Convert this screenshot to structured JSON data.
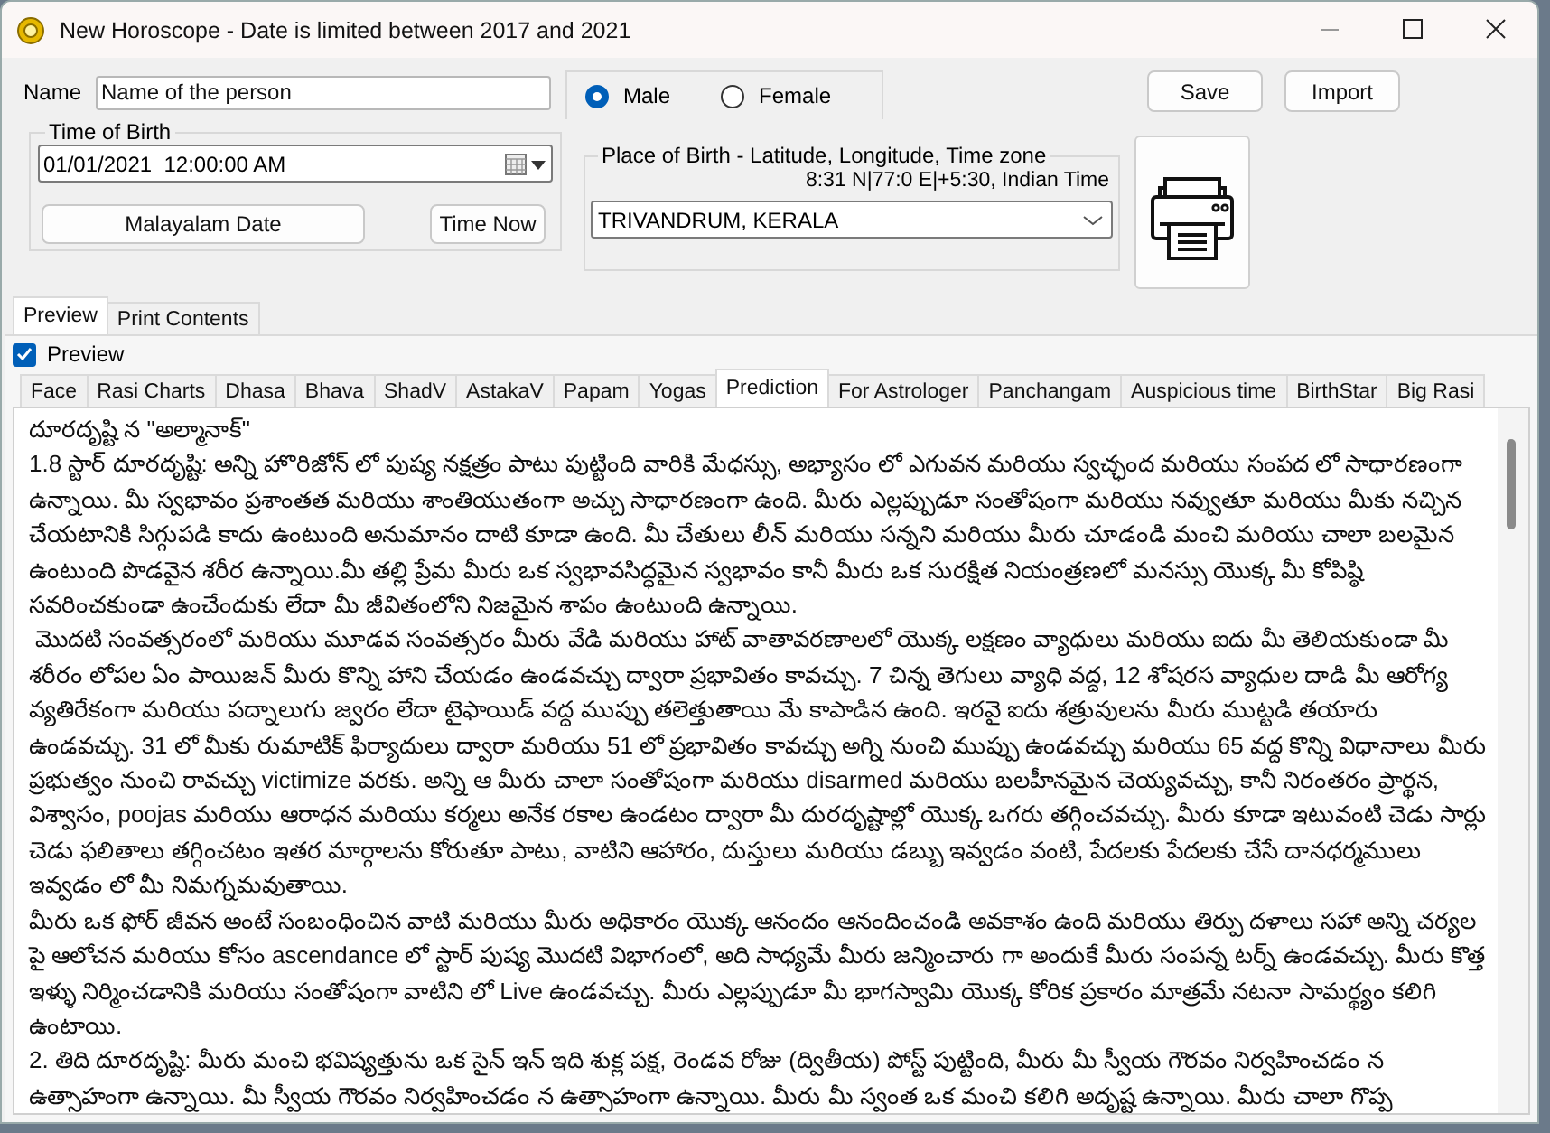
{
  "window": {
    "title": "New Horoscope - Date is limited between 2017 and 2021"
  },
  "name": {
    "label": "Name",
    "value": "Name of the person"
  },
  "gender": [
    {
      "label": "Male",
      "selected": true
    },
    {
      "label": "Female",
      "selected": false
    }
  ],
  "buttons": [
    "Save",
    "Import"
  ],
  "time_of_birth": {
    "title": "Time of Birth",
    "value": "01/01/2021  12:00:00 AM",
    "buttons": [
      "Malayalam Date",
      "Time Now"
    ]
  },
  "place_of_birth": {
    "title": "Place of Birth - Latitude, Longitude, Time zone",
    "coordinates": "8:31 N|77:0 E|+5:30, Indian Time",
    "value": "TRIVANDRUM, KERALA"
  },
  "outer_tabs": [
    {
      "label": "Preview",
      "selected": true
    },
    {
      "label": "Print Contents",
      "selected": false
    }
  ],
  "preview_checkbox": {
    "label": "Preview",
    "checked": true
  },
  "tabs": [
    {
      "label": "Face",
      "selected": false
    },
    {
      "label": "Rasi Charts",
      "selected": false
    },
    {
      "label": "Dhasa",
      "selected": false
    },
    {
      "label": "Bhava",
      "selected": false
    },
    {
      "label": "ShadV",
      "selected": false
    },
    {
      "label": "AstakaV",
      "selected": false
    },
    {
      "label": "Papam",
      "selected": false
    },
    {
      "label": "Yogas",
      "selected": false
    },
    {
      "label": "Prediction",
      "selected": true
    },
    {
      "label": "For Astrologer",
      "selected": false
    },
    {
      "label": "Panchangam",
      "selected": false
    },
    {
      "label": "Auspicious time",
      "selected": false
    },
    {
      "label": "BirthStar",
      "selected": false
    },
    {
      "label": "Big Rasi",
      "selected": false
    }
  ],
  "prediction_text": [
    "దూరదృష్టి న \"అల్మానాక్\"",
    "1.8 స్టార్ దూరదృష్టి: అన్ని హొరిజోన్ లో పుష్య నక్షత్రం పాటు పుట్టింది వారికి మేధస్సు, అభ్యాసం లో ఎగువన మరియు స్వచ్ఛంద మరియు సంపద లో సాధారణంగా ఉన్నాయి. మీ స్వభావం ప్రశాంతత మరియు శాంతియుతంగా అచ్చు సాధారణంగా ఉంది. మీరు ఎల్లప్పుడూ సంతోషంగా మరియు నవ్వుతూ మరియు మీకు నచ్చిన చేయటానికి సిగ్గుపడి కాదు ఉంటుంది అనుమానం దాటి కూడా ఉంది. మీ చేతులు లీన్ మరియు సన్నని మరియు మీరు చూడండి మంచి మరియు చాలా బలమైన ఉంటుంది పొడవైన శరీర ఉన్నాయి.మీ తల్లి ప్రేమ మీరు ఒక స్వభావసిద్ధమైన స్వభావం కానీ మీరు ఒక సురక్షిత నియంత్రణలో మనస్సు యొక్క మీ కోపిష్ఠి సవరించకుండా ఉంచేందుకు లేదా మీ జీవితంలోని నిజమైన శాపం ఉంటుంది ఉన్నాయి.",
    " మొదటి సంవత్సరంలో మరియు మూడవ సంవత్సరం మీరు వేడి మరియు హాట్ వాతావరణాలలో యొక్క లక్షణం వ్యాధులు మరియు ఐదు మీ తెలియకుండా మీ శరీరం లోపల ఏం పాయిజన్ మీరు కొన్ని హాని చేయడం ఉండవచ్చు ద్వారా ప్రభావితం కావచ్చు. 7 చిన్న తెగులు వ్యాధి వద్ద, 12 శోషరస వ్యాధుల దాడి మీ ఆరోగ్య వ్యతిరేకంగా మరియు పద్నాలుగు జ్వరం లేదా టైఫాయిడ్ వద్ద ముప్పు తలెత్తుతాయి మే కాపాడిన ఉంది. ఇరవై ఐదు శత్రువులను మీరు ముట్టడి తయారు ఉండవచ్చు. 31 లో మీకు రుమాటిక్ ఫిర్యాదులు ద్వారా మరియు 51 లో ప్రభావితం కావచ్చు అగ్ని నుంచి ముప్పు ఉండవచ్చు మరియు 65 వద్ద కొన్ని విధానాలు మీరు ప్రభుత్వం నుంచి రావచ్చు victimize వరకు. అన్ని ఆ మీరు చాలా సంతోషంగా మరియు disarmed మరియు బలహీనమైన చెయ్యవచ్చు, కానీ నిరంతరం ప్రార్థన, విశ్వాసం, poojas మరియు ఆరాధన మరియు కర్మలు అనేక రకాల ఉండటం ద్వారా మీ దురదృష్టాల్లో యొక్క ఒగరు తగ్గించవచ్చు. మీరు కూడా ఇటువంటి చెడు సార్లు చెడు ఫలితాలు తగ్గించటం ఇతర మార్గాలను కోరుతూ పాటు, వాటిని ఆహారం, దుస్తులు మరియు డబ్బు ఇవ్వడం వంటి, పేదలకు పేదలకు చేసే దానధర్మములు ఇవ్వడం లో మీ నిమగ్నమవుతాయి.",
    "మీరు ఒక ఫోర్ జీవన అంటే సంబంధించిన వాటి మరియు మీరు అధికారం యొక్క ఆనందం ఆనందించండి అవకాశం ఉంది మరియు తిర్పు దళాలు సహా అన్ని చర్యల పై ఆలోచన మరియు కోసం ascendance లో స్టార్ పుష్య మొదటి విభాగంలో, అది సాధ్యమే మీరు జన్మించారు గా అందుకే మీరు సంపన్న టర్న్ ఉండవచ్చు. మీరు కొత్త ఇళ్ళు నిర్మించడానికి మరియు సంతోషంగా వాటిని లో Live ఉండవచ్చు. మీరు ఎల్లప్పుడూ మీ భాగస్వామి యొక్క కోరిక ప్రకారం మాత్రమే నటనా సామర్థ్యం కలిగి ఉంటాయి.",
    "2. తిది దూరదృష్టి: మీరు మంచి భవిష్యత్తును ఒక సైన్ ఇన్ ఇది శుక్ల పక్ష, రెండవ రోజు (ద్వితీయ) పోస్ట్ పుట్టింది, మీరు మీ స్వీయ గౌరవం నిర్వహించడం న ఉత్సాహంగా ఉన్నాయి. మీ స్వీయ గౌరవం నిర్వహించడం న ఉత్సాహంగా ఉన్నాయి. మీరు మీ స్వంత ఒక మంచి కలిగి అదృష్ట ఉన్నాయి. మీరు చాలా గొప్ప"
  ]
}
